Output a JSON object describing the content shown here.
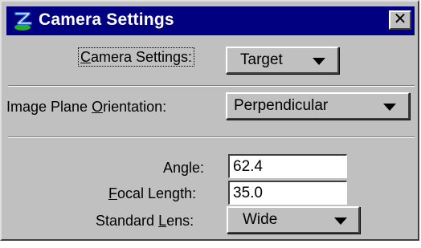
{
  "window": {
    "title": "Camera Settings",
    "close_label": "✕",
    "icon": "microstation-logo-icon"
  },
  "camera_settings": {
    "label_pre": "",
    "label_mnemonic": "C",
    "label_post": "amera Settings:",
    "value": "Target"
  },
  "image_plane": {
    "label_pre": "Image Plane ",
    "label_mnemonic": "O",
    "label_post": "rientation:",
    "value": "Perpendicular"
  },
  "angle": {
    "label_pre": "An",
    "label_mnemonic": "g",
    "label_post": "le:",
    "value": "62.4"
  },
  "focal_length": {
    "label_pre": "",
    "label_mnemonic": "F",
    "label_post": "ocal Length:",
    "value": "35.0"
  },
  "standard_lens": {
    "label_pre": "Standard ",
    "label_mnemonic": "L",
    "label_post": "ens:",
    "value": "Wide"
  },
  "colors": {
    "titlebar": "#000080",
    "face": "#c0c0c0",
    "logo_blue": "#1e6ee6",
    "logo_green": "#22b022"
  }
}
